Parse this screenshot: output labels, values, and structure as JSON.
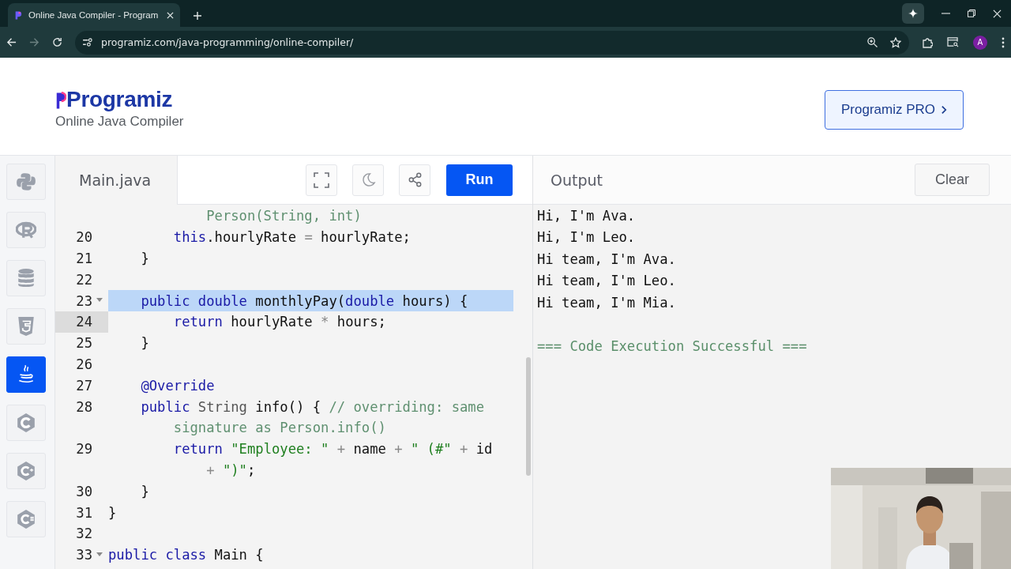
{
  "browser": {
    "tab_title": "Online Java Compiler - Program",
    "url": "programiz.com/java-programming/online-compiler/",
    "profile_initial": "A"
  },
  "header": {
    "logo": "Programiz",
    "subtitle": "Online Java Compiler",
    "pro_button": "Programiz PRO"
  },
  "sidebar": {
    "items": [
      {
        "kind": "python",
        "selected": false
      },
      {
        "kind": "r",
        "selected": false
      },
      {
        "kind": "sql",
        "selected": false
      },
      {
        "kind": "html",
        "selected": false
      },
      {
        "kind": "java",
        "selected": true
      },
      {
        "kind": "c",
        "selected": false
      },
      {
        "kind": "cpp",
        "selected": false
      },
      {
        "kind": "csharp",
        "selected": false
      }
    ]
  },
  "editor": {
    "filename": "Main.java",
    "run_button": "Run",
    "lines": [
      {
        "highlighted": false,
        "active": false,
        "foldable": false,
        "tokens": [
          {
            "kind": "comment",
            "text": "            Person(String, int)"
          }
        ]
      },
      {
        "number": "20",
        "highlighted": false,
        "active": false,
        "foldable": false,
        "tokens": [
          {
            "kind": "keyword",
            "text": "        this"
          },
          {
            "kind": "plain",
            "text": ".hourlyRate "
          },
          {
            "kind": "operator",
            "text": "="
          },
          {
            "kind": "plain",
            "text": " hourlyRate;"
          }
        ]
      },
      {
        "number": "21",
        "highlighted": false,
        "active": false,
        "foldable": false,
        "tokens": [
          {
            "kind": "plain",
            "text": "    }"
          }
        ]
      },
      {
        "number": "22",
        "highlighted": false,
        "active": false,
        "foldable": false
      },
      {
        "number": "23",
        "highlighted": true,
        "active": false,
        "foldable": true,
        "tokens": [
          {
            "kind": "keyword",
            "text": "    public double "
          },
          {
            "kind": "plain",
            "text": "monthlyPay("
          },
          {
            "kind": "keyword",
            "text": "double"
          },
          {
            "kind": "plain",
            "text": " hours) {"
          }
        ]
      },
      {
        "number": "24",
        "highlighted": false,
        "active": true,
        "foldable": false,
        "tokens": [
          {
            "kind": "keyword",
            "text": "        return"
          },
          {
            "kind": "plain",
            "text": " hourlyRate "
          },
          {
            "kind": "operator",
            "text": "*"
          },
          {
            "kind": "plain",
            "text": " hours;"
          }
        ]
      },
      {
        "number": "25",
        "highlighted": false,
        "active": false,
        "foldable": false,
        "tokens": [
          {
            "kind": "plain",
            "text": "    }"
          }
        ]
      },
      {
        "number": "26",
        "highlighted": false,
        "active": false,
        "foldable": false
      },
      {
        "number": "27",
        "highlighted": false,
        "active": false,
        "foldable": false,
        "tokens": [
          {
            "kind": "keyword",
            "text": "    @Override"
          }
        ]
      },
      {
        "number": "28",
        "highlighted": false,
        "active": false,
        "foldable": false,
        "tokens": [
          {
            "kind": "keyword",
            "text": "    public "
          },
          {
            "kind": "type",
            "text": "String "
          },
          {
            "kind": "plain",
            "text": "info() { "
          },
          {
            "kind": "comment",
            "text": "// overriding: same"
          }
        ]
      },
      {
        "highlighted": false,
        "active": false,
        "foldable": false,
        "tokens": [
          {
            "kind": "comment",
            "text": "        signature as Person.info()"
          }
        ]
      },
      {
        "number": "29",
        "highlighted": false,
        "active": false,
        "foldable": false,
        "tokens": [
          {
            "kind": "keyword",
            "text": "        return "
          },
          {
            "kind": "string",
            "text": "\"Employee: \""
          },
          {
            "kind": "operator",
            "text": " + "
          },
          {
            "kind": "plain",
            "text": "name"
          },
          {
            "kind": "operator",
            "text": " + "
          },
          {
            "kind": "string",
            "text": "\" (#\""
          },
          {
            "kind": "operator",
            "text": " + "
          },
          {
            "kind": "plain",
            "text": "id"
          }
        ]
      },
      {
        "highlighted": false,
        "active": false,
        "foldable": false,
        "tokens": [
          {
            "kind": "operator",
            "text": "            + "
          },
          {
            "kind": "string",
            "text": "\")\""
          },
          {
            "kind": "plain",
            "text": ";"
          }
        ]
      },
      {
        "number": "30",
        "highlighted": false,
        "active": false,
        "foldable": false,
        "tokens": [
          {
            "kind": "plain",
            "text": "    }"
          }
        ]
      },
      {
        "number": "31",
        "highlighted": false,
        "active": false,
        "foldable": false,
        "tokens": [
          {
            "kind": "plain",
            "text": "}"
          }
        ]
      },
      {
        "number": "32",
        "highlighted": false,
        "active": false,
        "foldable": false
      },
      {
        "number": "33",
        "highlighted": false,
        "active": false,
        "foldable": true,
        "tokens": [
          {
            "kind": "keyword",
            "text": "public class "
          },
          {
            "kind": "plain",
            "text": "Main {"
          }
        ]
      }
    ]
  },
  "output": {
    "title": "Output",
    "clear_button": "Clear",
    "lines": [
      {
        "kind": "plain",
        "text": "Hi, I'm Ava."
      },
      {
        "kind": "plain",
        "text": "Hi, I'm Leo."
      },
      {
        "kind": "plain",
        "text": "Hi team, I'm Ava."
      },
      {
        "kind": "plain",
        "text": "Hi team, I'm Leo."
      },
      {
        "kind": "plain",
        "text": "Hi team, I'm Mia."
      },
      {
        "kind": "success",
        "text": "=== Code Execution Successful ==="
      }
    ]
  }
}
